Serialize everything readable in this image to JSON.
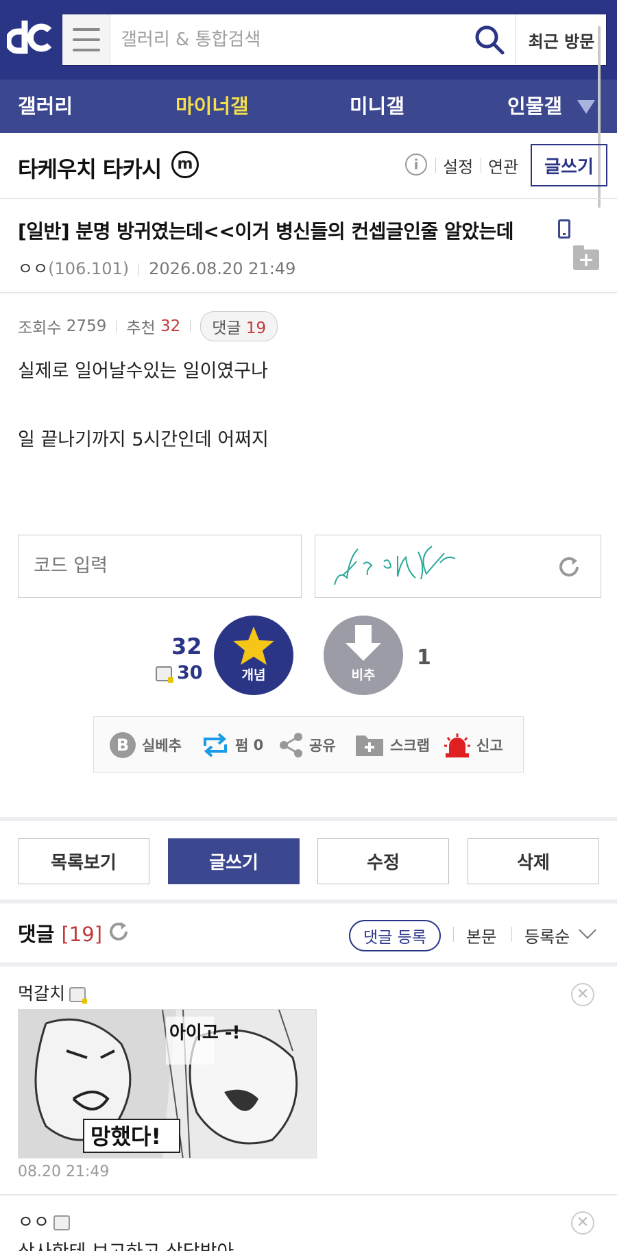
{
  "header": {
    "search_placeholder": "갤러리 & 통합검색",
    "recent_label": "최근 방문",
    "brand_color": "#2b3586"
  },
  "nav": {
    "items": [
      {
        "label": "갤러리",
        "active": false
      },
      {
        "label": "마이너갤",
        "active": true
      },
      {
        "label": "미니갤",
        "active": false
      },
      {
        "label": "인물갤",
        "active": false
      }
    ]
  },
  "gallery": {
    "title": "타케우치 타카시",
    "badge": "m",
    "settings_label": "설정",
    "related_label": "연관",
    "write_label": "글쓰기"
  },
  "post": {
    "title": "[일반] 분명 방귀였는데<<이거 병신들의 컨셉글인줄 알았는데",
    "author": "ㅇㅇ",
    "ip": "(106.101)",
    "date": "2026.08.20 21:49",
    "views_label": "조회수",
    "views": "2759",
    "recommend_label": "추천",
    "recommend": "32",
    "comments_label": "댓글",
    "comments": "19",
    "body_line1": "실제로 일어날수있는 일이였구나",
    "body_line2": "일 끝나기까지 5시간인데 어쩌지"
  },
  "captcha": {
    "code_placeholder": "코드 입력",
    "captcha_text": "ᄂ편 9ᄉ5ᄼ12ᄽ"
  },
  "vote": {
    "up_total": "32",
    "up_fixed": "30",
    "up_label": "개념",
    "down_label": "비추",
    "down_count": "1"
  },
  "actions": {
    "best": "실베추",
    "share_count_label": "펌",
    "share_count": "0",
    "share": "공유",
    "scrap": "스크랩",
    "report": "신고"
  },
  "bottom_buttons": {
    "list": "목록보기",
    "write": "글쓰기",
    "edit": "수정",
    "delete": "삭제"
  },
  "comments": {
    "title": "댓글",
    "count": "[19]",
    "register": "댓글 등록",
    "body_link": "본문",
    "sort": "등록순",
    "items": [
      {
        "author": "먹갈치",
        "image_text_1": "아이고\n-!",
        "image_text_2": "망했다!",
        "date": "08.20 21:49"
      },
      {
        "author": "ㅇㅇ",
        "text": "상사한테 보고하고 상담받아"
      }
    ]
  }
}
